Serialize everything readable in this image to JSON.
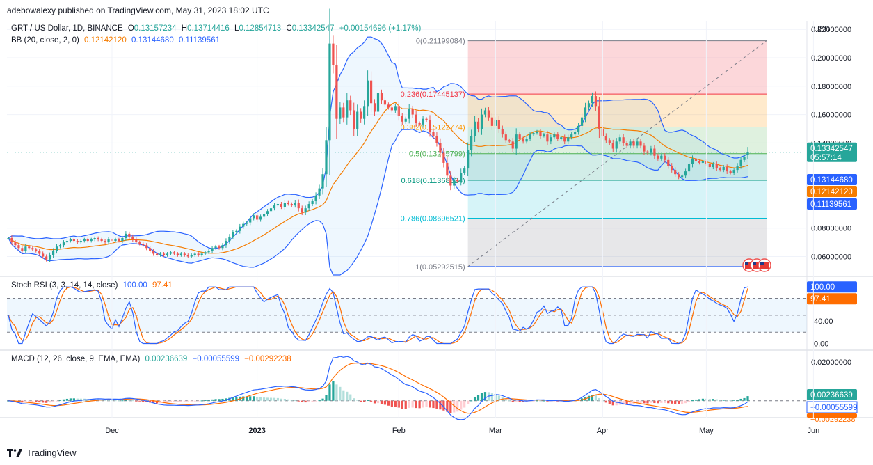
{
  "header": {
    "publisher_line": "adebowalexy published on TradingView.com, May 31, 2023 18:02 UTC"
  },
  "footer": {
    "brand": "TradingView",
    "logo_icon": "tradingview-logo-icon"
  },
  "main_pane": {
    "symbol_label": "GRT / US Dollar, 1D, BINANCE",
    "ohlc": {
      "o_label": "O",
      "o": "0.13157234",
      "h_label": "H",
      "h": "0.13714416",
      "l_label": "L",
      "l": "0.12854713",
      "c_label": "C",
      "c": "0.13342547",
      "change": "+0.00154696 (+1.17%)"
    },
    "bb_label": "BB (20, close, 2, 0)",
    "bb_values": [
      "0.12142120",
      "0.13144680",
      "0.11139561"
    ],
    "currency": "USD",
    "price_ticks": [
      "0.22000000",
      "0.20000000",
      "0.18000000",
      "0.16000000",
      "0.14000000",
      "0.08000000",
      "0.06000000"
    ],
    "badges": {
      "last_price": "0.13342547",
      "countdown": "05:57:14",
      "bb_upper": "0.13144680",
      "bb_basis": "0.12142120",
      "bb_lower": "0.11139561"
    },
    "fib_labels": [
      "0(0.21199084)",
      "0.236(0.17445137)",
      "0.382(0.15122774)",
      "0.5(0.13245799)",
      "0.618(0.11368824)",
      "0.786(0.08696521)",
      "1(0.05292515)"
    ]
  },
  "stoch_pane": {
    "label": "Stoch RSI (3, 3, 14, 14, close)",
    "k": "100.00",
    "d": "97.41",
    "ticks": [
      "40.00",
      "0.00"
    ],
    "badge_k": "100.00",
    "badge_d": "97.41"
  },
  "macd_pane": {
    "label": "MACD (12, 26, close, 9, EMA, EMA)",
    "hist": "0.00236639",
    "macd": "−0.00055599",
    "signal": "−0.00292238",
    "ticks": [
      "0.02000000"
    ],
    "badge_hist": "0.00236639",
    "badge_macd": "−0.00055599",
    "badge_signal": "−0.00292238"
  },
  "time_axis": [
    "Dec",
    "2023",
    "Feb",
    "Mar",
    "Apr",
    "May",
    "Jun"
  ],
  "colors": {
    "up": "#26a69a",
    "down": "#ef5350",
    "bb_basis": "#f57c00",
    "bb_band": "#2962ff",
    "macd_line": "#2962ff",
    "signal_line": "#ff6d00",
    "grid": "#f0f3fa"
  },
  "chart_data": [
    {
      "type": "candlestick",
      "title": "GRT / US Dollar, 1D, BINANCE",
      "ylabel": "USD",
      "ylim": [
        0.047,
        0.226
      ],
      "x_ticks": [
        "Dec",
        "2023",
        "Feb",
        "Mar",
        "Apr",
        "May",
        "Jun"
      ],
      "last": {
        "open": 0.13157234,
        "high": 0.13714416,
        "low": 0.12854713,
        "close": 0.13342547
      },
      "close_series": [
        0.073,
        0.07,
        0.068,
        0.066,
        0.064,
        0.067,
        0.066,
        0.065,
        0.064,
        0.062,
        0.06,
        0.058,
        0.061,
        0.064,
        0.067,
        0.068,
        0.07,
        0.071,
        0.072,
        0.071,
        0.07,
        0.071,
        0.072,
        0.071,
        0.072,
        0.073,
        0.072,
        0.071,
        0.07,
        0.072,
        0.071,
        0.072,
        0.071,
        0.073,
        0.076,
        0.074,
        0.072,
        0.07,
        0.069,
        0.068,
        0.066,
        0.064,
        0.062,
        0.061,
        0.062,
        0.061,
        0.062,
        0.063,
        0.062,
        0.061,
        0.062,
        0.061,
        0.06,
        0.061,
        0.062,
        0.061,
        0.062,
        0.063,
        0.064,
        0.066,
        0.067,
        0.066,
        0.068,
        0.071,
        0.074,
        0.077,
        0.078,
        0.081,
        0.083,
        0.084,
        0.087,
        0.089,
        0.086,
        0.088,
        0.09,
        0.092,
        0.094,
        0.096,
        0.097,
        0.095,
        0.098,
        0.097,
        0.096,
        0.098,
        0.094,
        0.091,
        0.094,
        0.097,
        0.099,
        0.103,
        0.108,
        0.118,
        0.142,
        0.21,
        0.195,
        0.157,
        0.165,
        0.158,
        0.17,
        0.163,
        0.15,
        0.162,
        0.157,
        0.166,
        0.184,
        0.168,
        0.162,
        0.175,
        0.17,
        0.167,
        0.165,
        0.163,
        0.166,
        0.159,
        0.155,
        0.157,
        0.164,
        0.16,
        0.154,
        0.153,
        0.157,
        0.156,
        0.148,
        0.145,
        0.14,
        0.133,
        0.126,
        0.117,
        0.11,
        0.114,
        0.113,
        0.119,
        0.122,
        0.135,
        0.145,
        0.155,
        0.15,
        0.16,
        0.163,
        0.158,
        0.152,
        0.156,
        0.15,
        0.146,
        0.142,
        0.141,
        0.136,
        0.146,
        0.143,
        0.141,
        0.143,
        0.146,
        0.147,
        0.148,
        0.145,
        0.146,
        0.141,
        0.144,
        0.146,
        0.143,
        0.144,
        0.141,
        0.144,
        0.146,
        0.148,
        0.152,
        0.158,
        0.165,
        0.168,
        0.173,
        0.166,
        0.15,
        0.145,
        0.142,
        0.14,
        0.136,
        0.141,
        0.144,
        0.14,
        0.138,
        0.141,
        0.138,
        0.141,
        0.138,
        0.134,
        0.133,
        0.136,
        0.131,
        0.129,
        0.131,
        0.128,
        0.124,
        0.121,
        0.118,
        0.116,
        0.117,
        0.12,
        0.125,
        0.129,
        0.127,
        0.126,
        0.127,
        0.125,
        0.123,
        0.125,
        0.122,
        0.121,
        0.123,
        0.12,
        0.119,
        0.121,
        0.124,
        0.128,
        0.13,
        0.1334
      ],
      "bollinger": {
        "basis": "SMA20",
        "upper_last": 0.1314468,
        "basis_last": 0.1214212,
        "lower_last": 0.11139561
      },
      "fibonacci_retracement": [
        {
          "level": 0,
          "price": 0.21199084
        },
        {
          "level": 0.236,
          "price": 0.17445137
        },
        {
          "level": 0.382,
          "price": 0.15122774
        },
        {
          "level": 0.5,
          "price": 0.13245799
        },
        {
          "level": 0.618,
          "price": 0.11368824
        },
        {
          "level": 0.786,
          "price": 0.08696521
        },
        {
          "level": 1,
          "price": 0.05292515
        }
      ]
    },
    {
      "type": "line",
      "title": "Stoch RSI (3, 3, 14, 14, close)",
      "ylim": [
        -8,
        115
      ],
      "levels": [
        80,
        50,
        20
      ],
      "series": [
        {
          "name": "K",
          "last": 100.0
        },
        {
          "name": "D",
          "last": 97.41
        }
      ]
    },
    {
      "type": "bar",
      "title": "MACD (12, 26, close, 9, EMA, EMA)",
      "ylim": [
        -0.008,
        0.025
      ],
      "series": [
        {
          "name": "Histogram",
          "last": 0.00236639
        },
        {
          "name": "MACD",
          "last": -0.00055599
        },
        {
          "name": "Signal",
          "last": -0.00292238
        }
      ]
    }
  ]
}
